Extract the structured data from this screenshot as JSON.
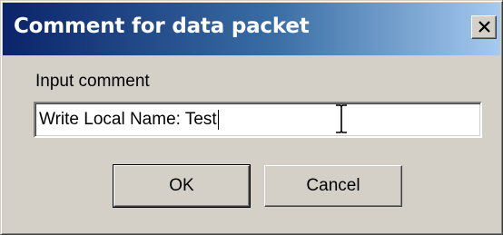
{
  "window": {
    "title": "Comment for data packet",
    "close_icon": "close-x-icon"
  },
  "form": {
    "label": "Input comment",
    "input_value": "Write Local Name: Test"
  },
  "buttons": {
    "ok_label": "OK",
    "cancel_label": "Cancel"
  },
  "colors": {
    "titlebar_start": "#0a246a",
    "titlebar_end": "#a6caf0",
    "dialog_face": "#d4d0c8"
  }
}
